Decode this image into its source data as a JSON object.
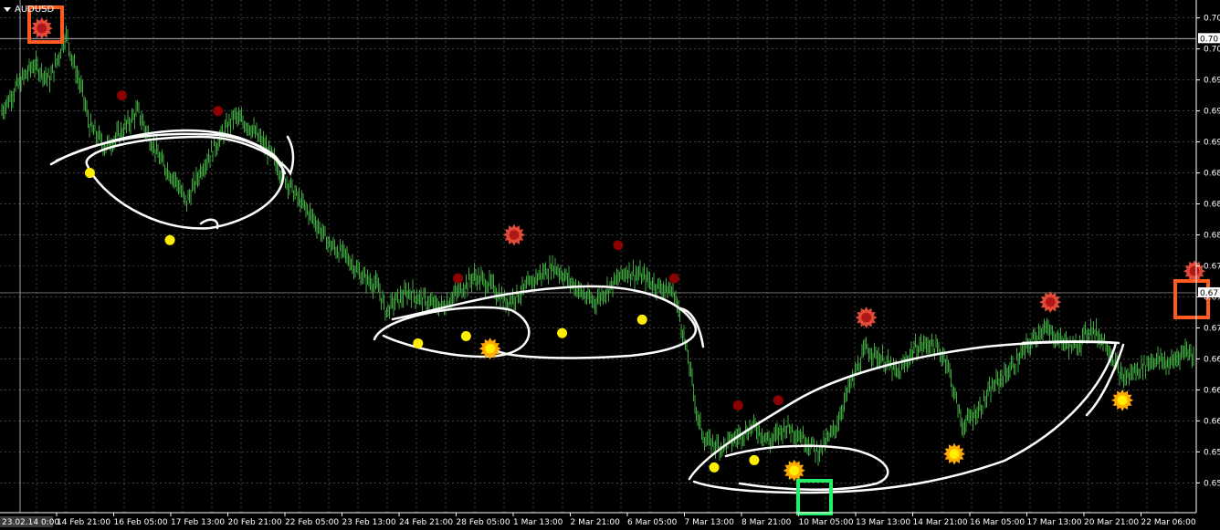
{
  "window": {
    "symbol_label": "AUDUSD",
    "menu_icon": "triangle-down-icon"
  },
  "colors": {
    "background": "#000000",
    "grid": "#6b6b6b",
    "price_bar": "#3fa83f",
    "annotation": "#ffffff",
    "signal_yellow": "#ffee00",
    "signal_darkred": "#8b0000",
    "star_red": "#e24a3a",
    "star_orange": "#ffaa00",
    "box_orange": "#ff5a1f",
    "box_green": "#22ee66"
  },
  "chart_data": {
    "type": "bar",
    "subtype": "ohlc-price-chart",
    "grid": true,
    "x_axis": {
      "start_label": "23.02.14 0:00",
      "tick_labels": [
        "14 Feb 21:00",
        "16 Feb 05:00",
        "17 Feb 13:00",
        "20 Feb 21:00",
        "22 Feb 05:00",
        "23 Feb 13:00",
        "24 Feb 21:00",
        "28 Feb 05:00",
        "1 Mar 13:00",
        "2 Mar 21:00",
        "6 Mar 05:00",
        "7 Mar 13:00",
        "8 Mar 21:00",
        "10 Mar 05:00",
        "13 Mar 13:00",
        "14 Mar 21:00",
        "16 Mar 05:00",
        "17 Mar 13:00",
        "20 Mar 21:00",
        "22 Mar 06:00"
      ]
    },
    "y_axis": {
      "ylim": [
        0.655,
        0.7025
      ],
      "tick_labels": [
        "0.70",
        "0.70",
        "0.69",
        "0.69",
        "0.69",
        "0.68",
        "0.68",
        "0.68",
        "0.67",
        "0.67",
        "0.67",
        "0.66",
        "0.66",
        "0.66",
        "0.65",
        "0.65"
      ],
      "tick_values": [
        0.702,
        0.699,
        0.696,
        0.693,
        0.69,
        0.687,
        0.684,
        0.681,
        0.678,
        0.675,
        0.672,
        0.669,
        0.666,
        0.663,
        0.66,
        0.657
      ]
    },
    "current_price": {
      "label": "0.67",
      "value": 0.6754
    },
    "line_price": {
      "label": "0.70",
      "value": 0.7
    },
    "price_path": [
      [
        0,
        0.693
      ],
      [
        2,
        0.6955
      ],
      [
        4,
        0.6975
      ],
      [
        6,
        0.696
      ],
      [
        7,
        0.698
      ],
      [
        8,
        0.7005
      ],
      [
        9,
        0.6975
      ],
      [
        10,
        0.695
      ],
      [
        11,
        0.6915
      ],
      [
        13,
        0.6895
      ],
      [
        15,
        0.691
      ],
      [
        17,
        0.693
      ],
      [
        18,
        0.6912
      ],
      [
        20,
        0.688
      ],
      [
        22,
        0.686
      ],
      [
        23,
        0.684
      ],
      [
        25,
        0.6875
      ],
      [
        27,
        0.69
      ],
      [
        29,
        0.6925
      ],
      [
        31,
        0.6915
      ],
      [
        33,
        0.6895
      ],
      [
        35,
        0.687
      ],
      [
        37,
        0.6845
      ],
      [
        39,
        0.6825
      ],
      [
        41,
        0.68
      ],
      [
        43,
        0.679
      ],
      [
        45,
        0.677
      ],
      [
        47,
        0.676
      ],
      [
        48,
        0.6735
      ],
      [
        49,
        0.6745
      ],
      [
        51,
        0.6755
      ],
      [
        53,
        0.6745
      ],
      [
        55,
        0.674
      ],
      [
        57,
        0.6755
      ],
      [
        59,
        0.677
      ],
      [
        61,
        0.6762
      ],
      [
        63,
        0.6745
      ],
      [
        65,
        0.6755
      ],
      [
        67,
        0.677
      ],
      [
        69,
        0.678
      ],
      [
        71,
        0.6765
      ],
      [
        73,
        0.675
      ],
      [
        74,
        0.6745
      ],
      [
        76,
        0.676
      ],
      [
        78,
        0.6775
      ],
      [
        80,
        0.677
      ],
      [
        82,
        0.676
      ],
      [
        84,
        0.6755
      ],
      [
        85,
        0.672
      ],
      [
        86,
        0.668
      ],
      [
        87,
        0.663
      ],
      [
        88,
        0.661
      ],
      [
        90,
        0.6605
      ],
      [
        92,
        0.6615
      ],
      [
        94,
        0.6625
      ],
      [
        96,
        0.661
      ],
      [
        98,
        0.6625
      ],
      [
        100,
        0.6615
      ],
      [
        102,
        0.66
      ],
      [
        104,
        0.662
      ],
      [
        106,
        0.6665
      ],
      [
        108,
        0.67
      ],
      [
        110,
        0.669
      ],
      [
        112,
        0.6675
      ],
      [
        114,
        0.67
      ],
      [
        116,
        0.6705
      ],
      [
        118,
        0.669
      ],
      [
        120,
        0.6625
      ],
      [
        122,
        0.664
      ],
      [
        124,
        0.6665
      ],
      [
        126,
        0.668
      ],
      [
        128,
        0.67
      ],
      [
        130,
        0.672
      ],
      [
        132,
        0.671
      ],
      [
        134,
        0.67
      ],
      [
        136,
        0.672
      ],
      [
        138,
        0.6705
      ],
      [
        140,
        0.667
      ],
      [
        142,
        0.668
      ],
      [
        144,
        0.669
      ],
      [
        146,
        0.6685
      ],
      [
        148,
        0.67
      ],
      [
        149,
        0.669
      ]
    ],
    "signals": [
      {
        "kind": "dot-yellow",
        "x": 11,
        "y": 0.687
      },
      {
        "kind": "dot-yellow",
        "x": 21,
        "y": 0.6805
      },
      {
        "kind": "dot-darkred",
        "x": 15,
        "y": 0.6945
      },
      {
        "kind": "dot-darkred",
        "x": 27,
        "y": 0.693
      },
      {
        "kind": "dot-yellow",
        "x": 52,
        "y": 0.6705
      },
      {
        "kind": "dot-yellow",
        "x": 58,
        "y": 0.6712
      },
      {
        "kind": "dot-yellow",
        "x": 70,
        "y": 0.6715
      },
      {
        "kind": "dot-yellow",
        "x": 80,
        "y": 0.6728
      },
      {
        "kind": "dot-darkred",
        "x": 57,
        "y": 0.6768
      },
      {
        "kind": "dot-darkred",
        "x": 77,
        "y": 0.68
      },
      {
        "kind": "dot-darkred",
        "x": 84,
        "y": 0.6768
      },
      {
        "kind": "star-red",
        "x": 64,
        "y": 0.681
      },
      {
        "kind": "star-orange",
        "x": 61,
        "y": 0.67
      },
      {
        "kind": "dot-yellow",
        "x": 89,
        "y": 0.6585
      },
      {
        "kind": "dot-yellow",
        "x": 94,
        "y": 0.6592
      },
      {
        "kind": "dot-darkred",
        "x": 92,
        "y": 0.6645
      },
      {
        "kind": "dot-darkred",
        "x": 97,
        "y": 0.665
      },
      {
        "kind": "star-orange",
        "x": 99,
        "y": 0.6582
      },
      {
        "kind": "star-red",
        "x": 108,
        "y": 0.673
      },
      {
        "kind": "star-orange",
        "x": 119,
        "y": 0.6598
      },
      {
        "kind": "star-red",
        "x": 131,
        "y": 0.6745
      },
      {
        "kind": "star-orange",
        "x": 140,
        "y": 0.665
      },
      {
        "kind": "star-red",
        "x": 5,
        "y": 0.701
      },
      {
        "kind": "star-red",
        "x": 149,
        "y": 0.6775
      }
    ]
  }
}
